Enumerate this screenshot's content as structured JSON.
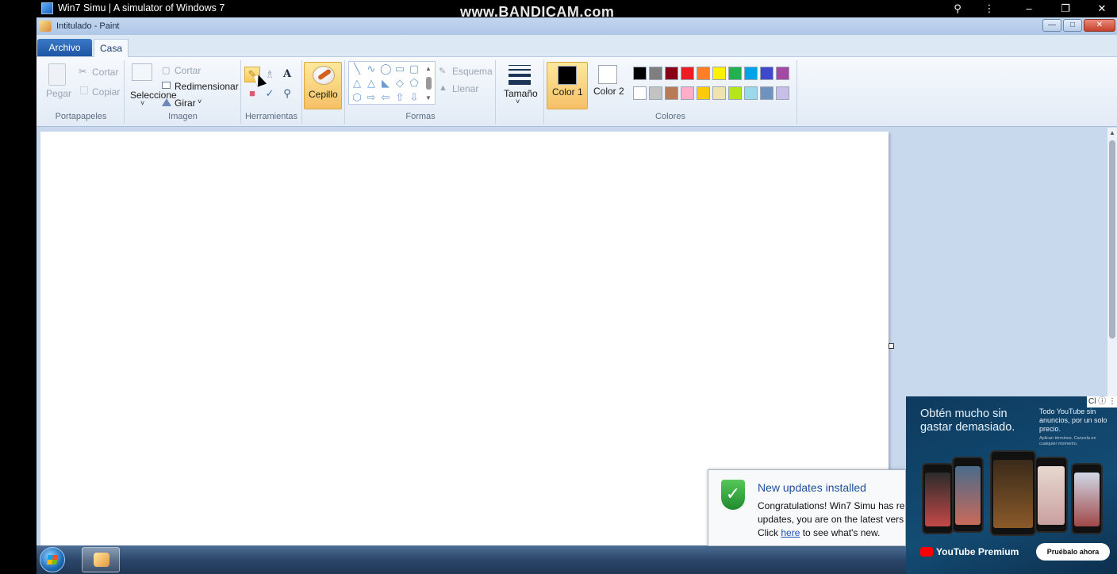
{
  "host": {
    "title": "Win7 Simu | A simulator of Windows 7",
    "watermark": "www.BANDICAM.com",
    "controls": [
      "search-icon",
      "more-icon",
      "minimize-icon",
      "restore-icon",
      "close-icon"
    ]
  },
  "paint": {
    "title": "Intitulado - Paint",
    "tabs": {
      "file": "Archivo",
      "home": "Casa"
    },
    "clipboard": {
      "paste": "Pegar",
      "cut": "Cortar",
      "copy": "Copiar",
      "label": "Portapapeles"
    },
    "image": {
      "select": "Seleccione",
      "crop": "Cortar",
      "resize": "Redimensionar",
      "rotate": "Girar",
      "label": "Imagen"
    },
    "tools": {
      "label": "Herramientas",
      "text_tool": "A"
    },
    "brush": {
      "label": "Cepillo"
    },
    "shapes": {
      "outline": "Esquema",
      "fill": "Llenar",
      "label": "Formas"
    },
    "size": {
      "label": "Tamaño"
    },
    "colors": {
      "color1": "Color 1",
      "color2": "Color 2",
      "label": "Colores",
      "color1_value": "#000000",
      "color2_value": "#ffffff",
      "row1": [
        "#000000",
        "#7f7f7f",
        "#880015",
        "#ed1c24",
        "#ff7f27",
        "#fff200",
        "#22b14c",
        "#00a2e8",
        "#3f48cc",
        "#a349a4"
      ],
      "row2": [
        "#ffffff",
        "#c3c3c3",
        "#b97a57",
        "#ffaec9",
        "#ffc90e",
        "#efe4b0",
        "#b5e61d",
        "#99d9ea",
        "#7092be",
        "#c8bfe7"
      ]
    }
  },
  "notification": {
    "title": "New updates installed",
    "line1": "Congratulations! Win7 Simu has re",
    "line2": "updates, you are on the latest vers",
    "line3_before": "Click ",
    "link": "here",
    "line3_after": " to see what's new."
  },
  "ad": {
    "close": "Cl",
    "headline": "Obtén mucho sin gastar demasiado.",
    "sub": "Todo YouTube sin anuncios, por un solo precio.",
    "fine": "Aplican términos. Cancela en cualquier momento.",
    "brand": "YouTube Premium",
    "cta": "Pruébalo ahora"
  }
}
